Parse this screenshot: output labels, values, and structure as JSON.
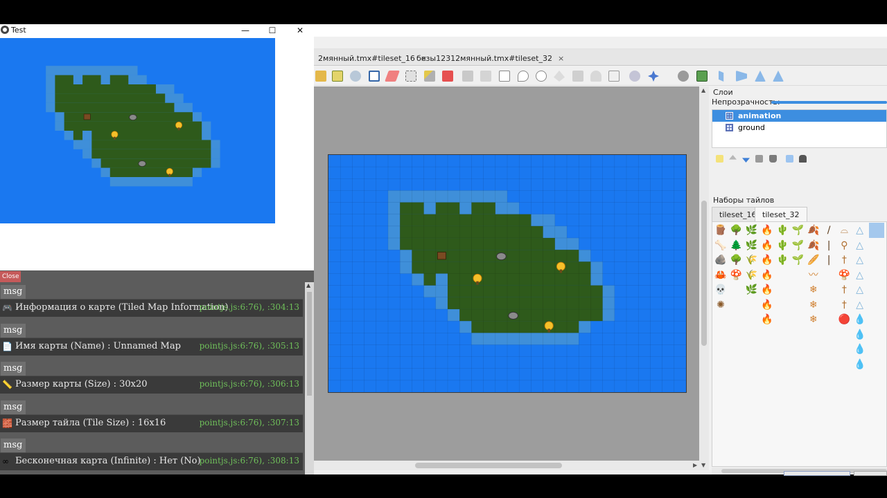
{
  "test_window": {
    "title": "Test",
    "controls": {
      "minimize": "—",
      "maximize": "☐",
      "close": "✕"
    }
  },
  "editor": {
    "tabs": [
      {
        "label": "2мянный.tmx#tileset_16",
        "close": "×"
      },
      {
        "label": "безы12312мянный.tmx#tileset_32",
        "close": "×"
      }
    ],
    "panel": {
      "layers_title": "Слои",
      "opacity_label": "Непрозрачность:",
      "layers": [
        "animation",
        "ground"
      ],
      "tilesets_title": "Наборы тайлов",
      "tileset_tabs": [
        "tileset_16",
        "tileset_32"
      ]
    }
  },
  "console": {
    "close_label": "Close",
    "entries": [
      {
        "tag": "msg",
        "icon": "gamepad-icon",
        "emoji": "🎮",
        "text": "Информация о карте (Tiled Map Information)",
        "source": "pointjs.js:6:76), :304:13"
      },
      {
        "tag": "msg",
        "icon": "memo-icon",
        "emoji": "📄",
        "text": "Имя карты (Name) :  Unnamed Map",
        "source": "pointjs.js:6:76), :305:13"
      },
      {
        "tag": "msg",
        "icon": "ruler-icon",
        "emoji": "📏",
        "text": "Размер карты (Size) :  30x20",
        "source": "pointjs.js:6:76), :306:13"
      },
      {
        "tag": "msg",
        "icon": "brick-icon",
        "emoji": "🧱",
        "text": "Размер тайла (Tile Size) :  16x16",
        "source": "pointjs.js:6:76), :307:13"
      },
      {
        "tag": "msg",
        "icon": "infinity-icon",
        "emoji": "∞",
        "text": "Бесконечная карта (Infinite) :  Нет (No)",
        "source": "pointjs.js:6:76), :308:13"
      }
    ]
  },
  "colors": {
    "water": "#1a78f0",
    "shore": "#3f8fd9",
    "grass": "#2e5a1b",
    "selection": "#3d8ee0",
    "console_bg": "#5c5c5c",
    "log_source": "#6fbf5a"
  }
}
